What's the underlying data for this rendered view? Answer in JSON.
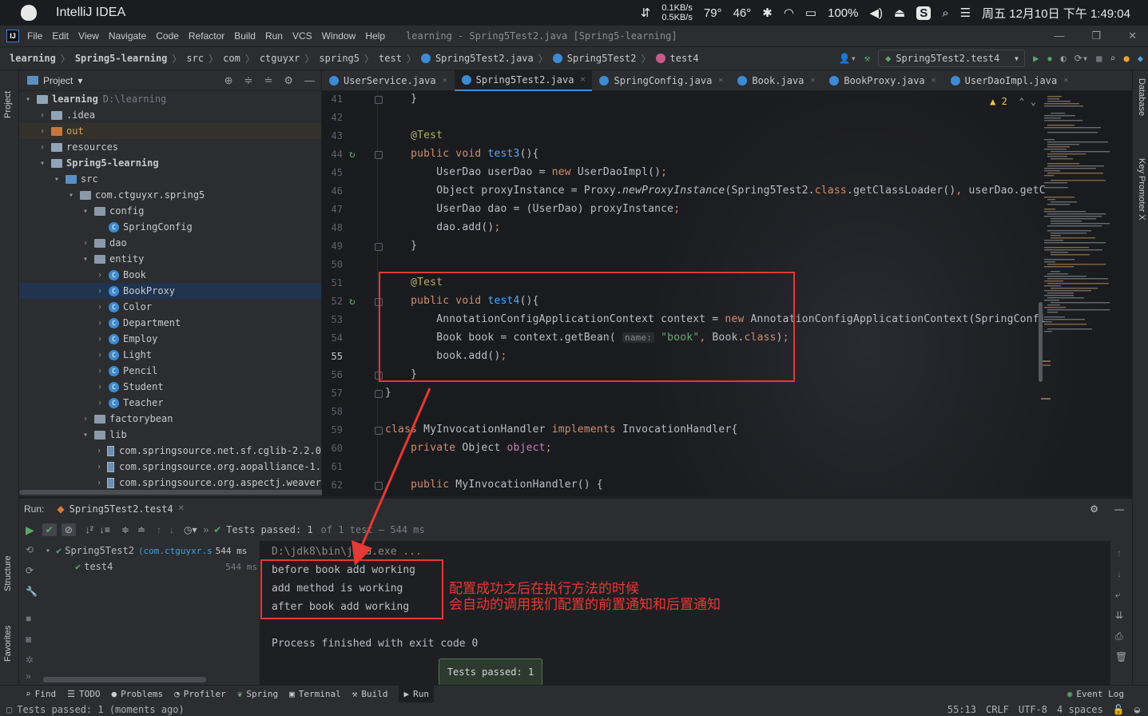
{
  "macbar": {
    "app_name": "IntelliJ IDEA",
    "net_up": "0.1KB/s",
    "net_down": "0.5KB/s",
    "temp1": "79°",
    "temp2": "46°",
    "battery": "100%",
    "datetime": "周五 12月10日 下午 1:49:04"
  },
  "menu": {
    "items": [
      "File",
      "Edit",
      "View",
      "Navigate",
      "Code",
      "Refactor",
      "Build",
      "Run",
      "VCS",
      "Window",
      "Help"
    ],
    "window_title": "learning - Spring5Test2.java [Spring5-learning]"
  },
  "breadcrumb": [
    "learning",
    "Spring5-learning",
    "src",
    "com",
    "ctguyxr",
    "spring5",
    "test",
    "Spring5Test2.java",
    "Spring5Test2",
    "test4"
  ],
  "run_config": "Spring5Test2.test4",
  "project": {
    "title": "Project",
    "tree": [
      {
        "label": "learning",
        "extra": "D:\\learning",
        "bold": true
      },
      {
        "label": ".idea"
      },
      {
        "label": "out"
      },
      {
        "label": "resources"
      },
      {
        "label": "Spring5-learning",
        "bold": true
      },
      {
        "label": "src"
      },
      {
        "label": "com.ctguyxr.spring5"
      },
      {
        "label": "config"
      },
      {
        "label": "SpringConfig"
      },
      {
        "label": "dao"
      },
      {
        "label": "entity"
      },
      {
        "label": "Book"
      },
      {
        "label": "BookProxy"
      },
      {
        "label": "Color"
      },
      {
        "label": "Department"
      },
      {
        "label": "Employ"
      },
      {
        "label": "Light"
      },
      {
        "label": "Pencil"
      },
      {
        "label": "Student"
      },
      {
        "label": "Teacher"
      },
      {
        "label": "factorybean"
      },
      {
        "label": "lib"
      },
      {
        "label": "com.springsource.net.sf.cglib-2.2.0"
      },
      {
        "label": "com.springsource.org.aopalliance-1."
      },
      {
        "label": "com.springsource.org.aspectj.weaver"
      }
    ]
  },
  "tabs": [
    "UserService.java",
    "Spring5Test2.java",
    "SpringConfig.java",
    "Book.java",
    "BookProxy.java",
    "UserDaoImpl.java"
  ],
  "editor": {
    "warnings": "2",
    "line_numbers": [
      "41",
      "42",
      "43",
      "44",
      "45",
      "46",
      "47",
      "48",
      "49",
      "50",
      "51",
      "52",
      "53",
      "54",
      "55",
      "56",
      "57",
      "58",
      "59",
      "60",
      "61",
      "62"
    ],
    "lines": [
      {
        "n": "41",
        "html": "    }"
      },
      {
        "n": "42",
        "html": ""
      },
      {
        "n": "43",
        "html": "    <span class='an'>@Test</span>"
      },
      {
        "n": "44",
        "html": "    <span class='kw'>public void </span><span class='fn'>test3</span>(){"
      },
      {
        "n": "45",
        "html": "        UserDao userDao = <span class='kw'>new </span>UserDaoImpl()<span class='kw'>;</span>"
      },
      {
        "n": "46",
        "html": "        Object proxyInstance = Proxy.<span class='it'>newProxyInstance</span>(Spring5Test2.<span class='kw'>class</span>.getClassLoader()<span class='kw'>, </span>userDao.getC"
      },
      {
        "n": "47",
        "html": "        UserDao dao = (UserDao) proxyInstance<span class='kw'>;</span>"
      },
      {
        "n": "48",
        "html": "        dao.add()<span class='kw'>;</span>"
      },
      {
        "n": "49",
        "html": "    }"
      },
      {
        "n": "50",
        "html": ""
      },
      {
        "n": "51",
        "html": "    <span class='an'>@Test</span>"
      },
      {
        "n": "52",
        "html": "    <span class='kw'>public void </span><span class='fn'>test4</span>(){"
      },
      {
        "n": "53",
        "html": "        AnnotationConfigApplicationContext context = <span class='kw'>new </span>AnnotationConfigApplicationContext(SpringConfi"
      },
      {
        "n": "54",
        "html": "        Book book = context.getBean( <span class='hint'>name:</span> <span class='str'>\"book\"</span><span class='kw'>, </span>Book.<span class='kw'>class</span>)<span class='kw'>;</span>"
      },
      {
        "n": "55",
        "html": "        book.add()<span class='kw'>;</span>"
      },
      {
        "n": "56",
        "html": "    }"
      },
      {
        "n": "57",
        "html": "}"
      },
      {
        "n": "58",
        "html": ""
      },
      {
        "n": "59",
        "html": "<span class='kw'>class </span>MyInvocationHandler <span class='kw'>implements </span>InvocationHandler{"
      },
      {
        "n": "60",
        "html": "    <span class='kw'>private </span>Object <span class='fld'>object</span><span class='kw'>;</span>"
      },
      {
        "n": "61",
        "html": ""
      },
      {
        "n": "62",
        "html": "    <span class='kw'>public </span>MyInvocationHandler() {"
      }
    ]
  },
  "run": {
    "label": "Run:",
    "config_tab": "Spring5Test2.test4",
    "status": "Tests passed: 1",
    "status_detail": "of 1 test – 544 ms",
    "tree": [
      {
        "label": "Spring5Test2",
        "pkg": "(com.ctguyxr.s",
        "time": "544 ms"
      },
      {
        "label": "test4",
        "time": "544 ms"
      }
    ],
    "console": [
      "D:\\jdk8\\bin\\java.exe ...",
      "before book add working",
      "add method is working",
      "after book add working",
      "",
      "Process finished with exit code 0"
    ],
    "annotation_line1": "配置成功之后在执行方法的时候",
    "annotation_line2": "会自动的调用我们配置的前置通知和后置通知",
    "toast": "Tests passed: 1"
  },
  "bottom_tools": [
    "Find",
    "TODO",
    "Problems",
    "Profiler",
    "Spring",
    "Terminal",
    "Build",
    "Run"
  ],
  "event_log": "Event Log",
  "status": {
    "message": "Tests passed: 1 (moments ago)",
    "position": "55:13",
    "line_sep": "CRLF",
    "encoding": "UTF-8",
    "indent": "4 spaces"
  },
  "side_tools": {
    "left": [
      "Project",
      "Structure",
      "Favorites"
    ],
    "right": [
      "Database",
      "Key Promoter X"
    ]
  }
}
